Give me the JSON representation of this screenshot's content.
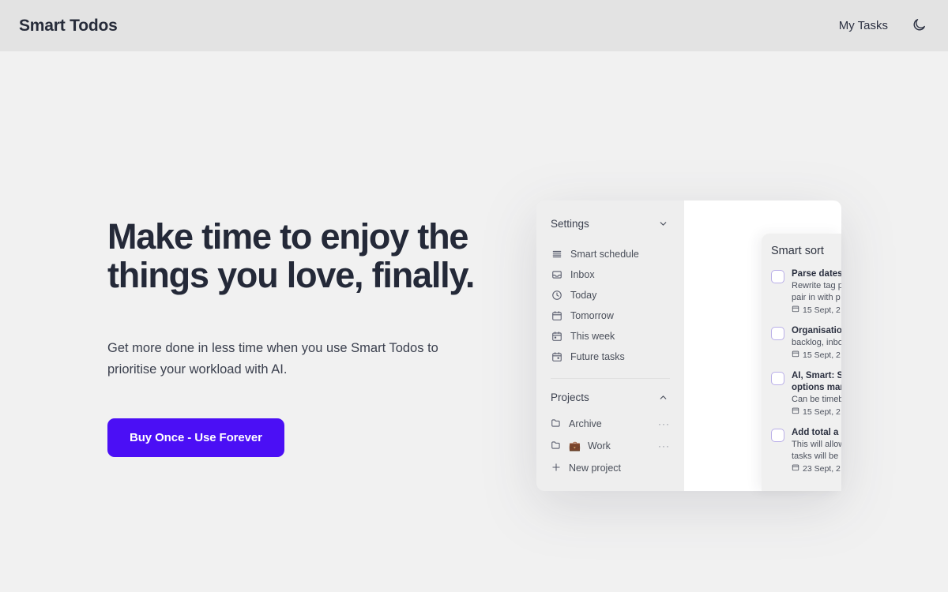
{
  "header": {
    "brand": "Smart Todos",
    "nav_link": "My Tasks",
    "theme_toggle_icon": "moon-icon"
  },
  "hero": {
    "title_line1": "Make time to enjoy the",
    "title_line2": "things you love, finally.",
    "subtitle": "Get more done in less time when you use Smart Todos to prioritise your workload with AI.",
    "cta_label": "Buy Once - Use Forever",
    "cta_color": "#4b0ff5"
  },
  "mockup": {
    "sidebar": {
      "settings_label": "Settings",
      "settings_chevron": "chevron-down-icon",
      "items": [
        {
          "label": "Smart schedule",
          "icon": "list-lines-icon"
        },
        {
          "label": "Inbox",
          "icon": "inbox-tray-icon"
        },
        {
          "label": "Today",
          "icon": "clock-icon"
        },
        {
          "label": "Tomorrow",
          "icon": "calendar-icon"
        },
        {
          "label": "This week",
          "icon": "calendar-week-icon"
        },
        {
          "label": "Future tasks",
          "icon": "calendar-future-icon"
        }
      ],
      "projects_label": "Projects",
      "projects_chevron": "chevron-up-icon",
      "projects": [
        {
          "label": "Archive",
          "icon": "folder-icon",
          "emoji": "",
          "menu": "···"
        },
        {
          "label": "Work",
          "icon": "folder-icon",
          "emoji": "💼",
          "menu": "···"
        }
      ],
      "new_project_label": "New project",
      "new_project_icon": "plus-icon"
    },
    "smart_sort": {
      "title": "Smart sort",
      "checkbox_color": "#b9aee8",
      "tasks": [
        {
          "title": "Parse dates",
          "desc_line1": "Rewrite tag p",
          "desc_line2": "pair in with p",
          "date": "15 Sept, 2",
          "date_icon": "calendar-icon"
        },
        {
          "title": "Organisatio",
          "desc_line1": "backlog, inbo",
          "desc_line2": "",
          "date": "15 Sept, 2",
          "date_icon": "calendar-icon"
        },
        {
          "title": "AI, Smart: S",
          "title_line2": "options man",
          "desc_line1": "Can be timeb",
          "desc_line2": "",
          "date": "15 Sept, 2",
          "date_icon": "calendar-icon"
        },
        {
          "title": "Add total a",
          "desc_line1": "This will allow",
          "desc_line2": "tasks will be",
          "date": "23 Sept, 2",
          "date_icon": "calendar-icon"
        }
      ]
    }
  }
}
